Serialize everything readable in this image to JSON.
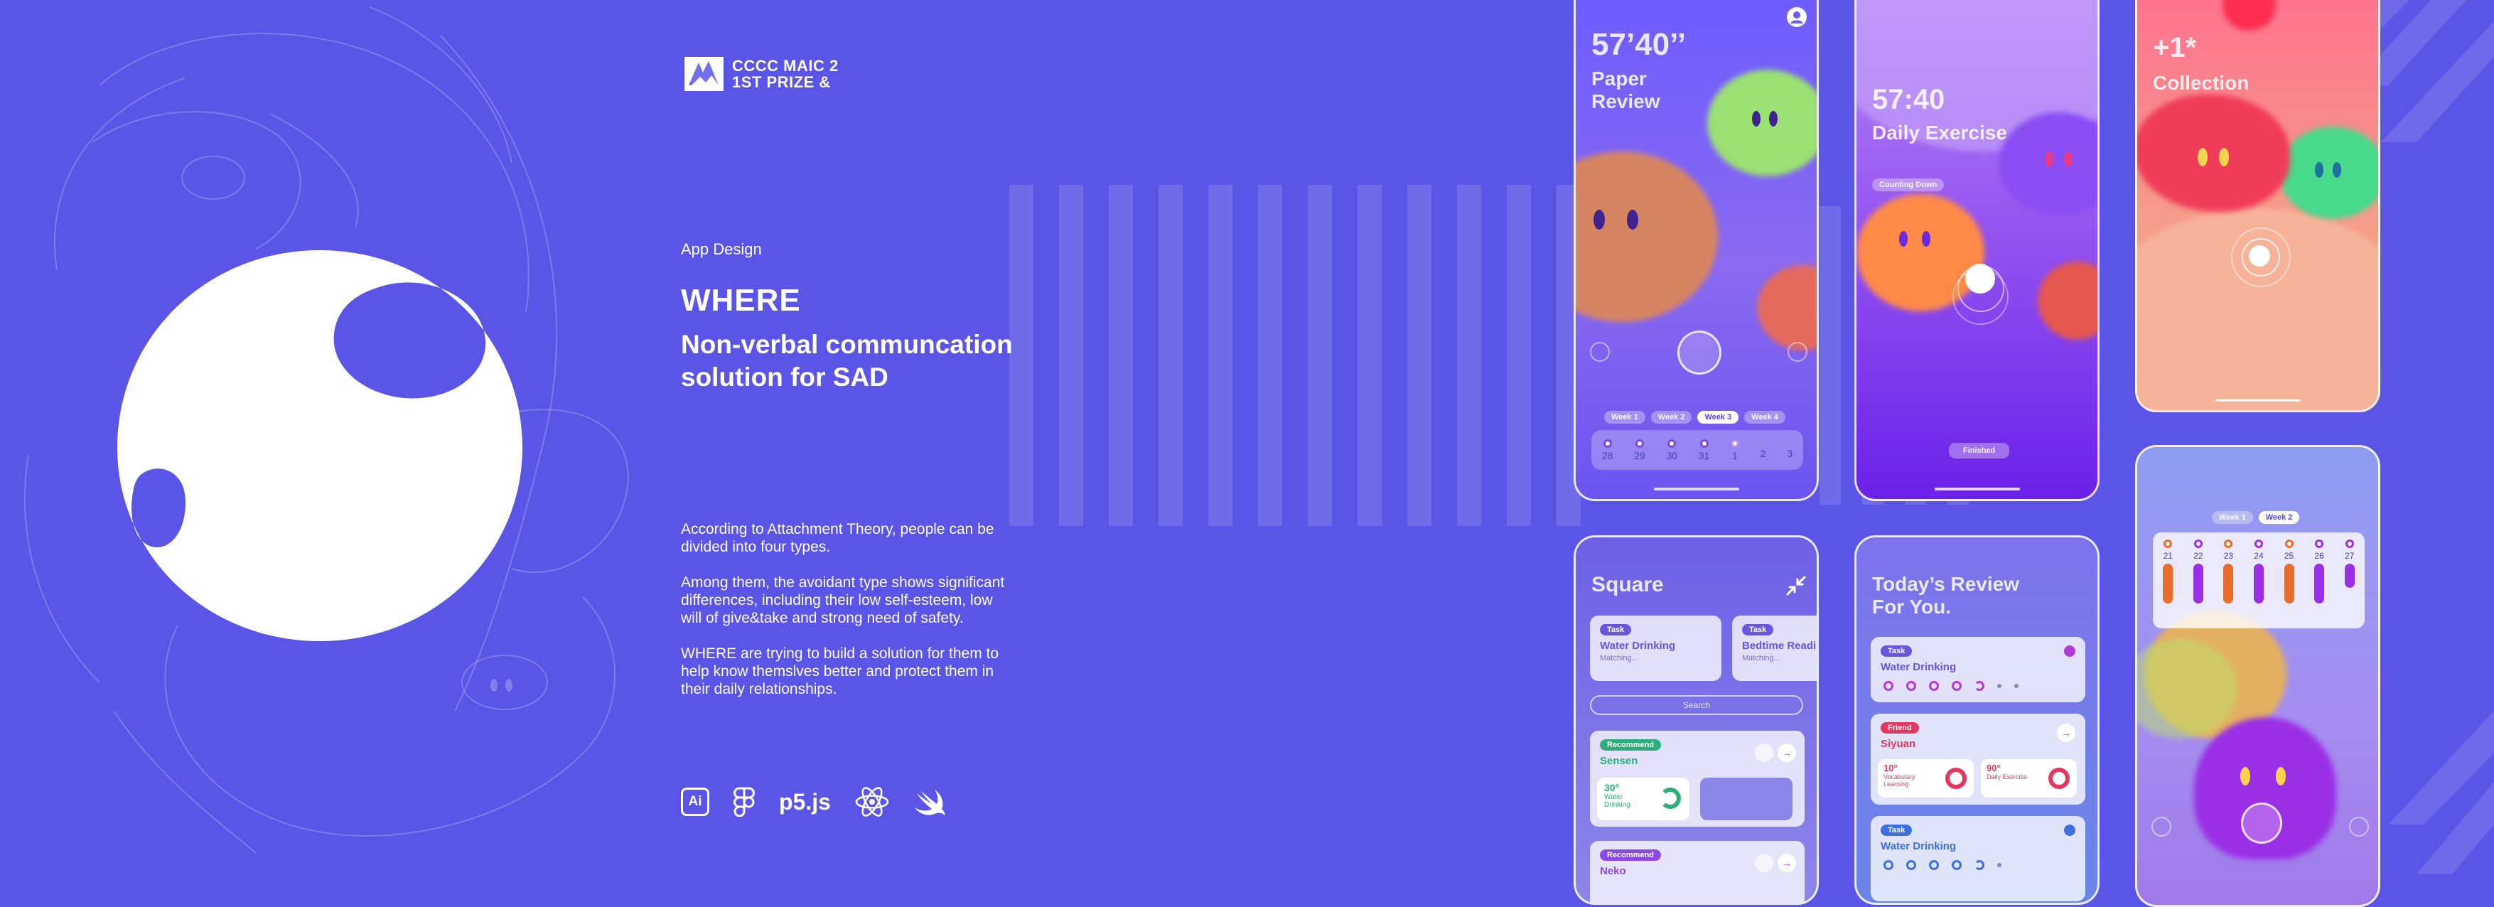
{
  "award": {
    "line1": "CCCC MAIC 2",
    "line2": "1ST PRIZE & "
  },
  "eyebrow": "App Design",
  "title": "WHERE",
  "subtitle": "Non-verbal communcation solution for SAD",
  "description": [
    "According to Attachment Theory, people can be divided into four types.",
    "Among them, the avoidant type shows significant differences, including their low self-esteem, low will of give&take and strong need of safety.",
    "WHERE are trying to build a solution for them to help know themslves better and protect them in their daily relationships."
  ],
  "tools": [
    {
      "icon": "illustrator-icon",
      "label": "Ai"
    },
    {
      "icon": "figma-icon",
      "label": ""
    },
    {
      "icon": "p5js-icon",
      "label": "p5.js"
    },
    {
      "icon": "react-icon",
      "label": ""
    },
    {
      "icon": "swift-icon",
      "label": ""
    }
  ],
  "phone_paper_review": {
    "time": "57’40’’",
    "title_line1": "Paper",
    "title_line2": "Review",
    "weeks": [
      "Week 1",
      "Week 2",
      "Week 3",
      "Week 4"
    ],
    "active_week": "Week 3",
    "dates": [
      "28",
      "29",
      "30",
      "31",
      "1",
      "2",
      "3"
    ]
  },
  "phone_daily_exercise": {
    "time": "57:40",
    "title": "Daily Exercise",
    "status": "Counting Down",
    "button": "Finished"
  },
  "phone_collection": {
    "count": "+1*",
    "title": "Collection"
  },
  "phone_square": {
    "title": "Square",
    "cards": [
      {
        "tag": "Task",
        "title": "Water Drinking",
        "sub": "Matching..."
      },
      {
        "tag": "Task",
        "title": "Bedtime Reading",
        "sub": "Matching..."
      }
    ],
    "search": "Search",
    "recommend": [
      {
        "tag": "Recommend",
        "name": "Sensen",
        "stat": "30°",
        "stat_label": "Water Drinking"
      },
      {
        "tag": "Recommend",
        "name": "Neko"
      }
    ]
  },
  "phone_today_review": {
    "title_line1": "Today’s Review",
    "title_line2": "For You.",
    "cards": [
      {
        "tag": "Task",
        "title": "Water Drinking"
      },
      {
        "tag": "Friend",
        "title": "Siyuan",
        "stat1": "10°",
        "stat1_label": "Vocabulary Learning",
        "stat2": "90°",
        "stat2_label": "Daily Exercise"
      },
      {
        "tag": "Task",
        "title": "Water Drinking"
      }
    ]
  },
  "phone_week_stats": {
    "weeks": [
      "Week 1",
      "Week 2"
    ],
    "active_week": "Week 2",
    "days": [
      "21",
      "22",
      "23",
      "24",
      "25",
      "26",
      "27"
    ]
  },
  "colors": {
    "background": "#5a55e6",
    "accent": "#6a55df",
    "friend": "#e2375e",
    "recommend": "#2cae7a"
  }
}
